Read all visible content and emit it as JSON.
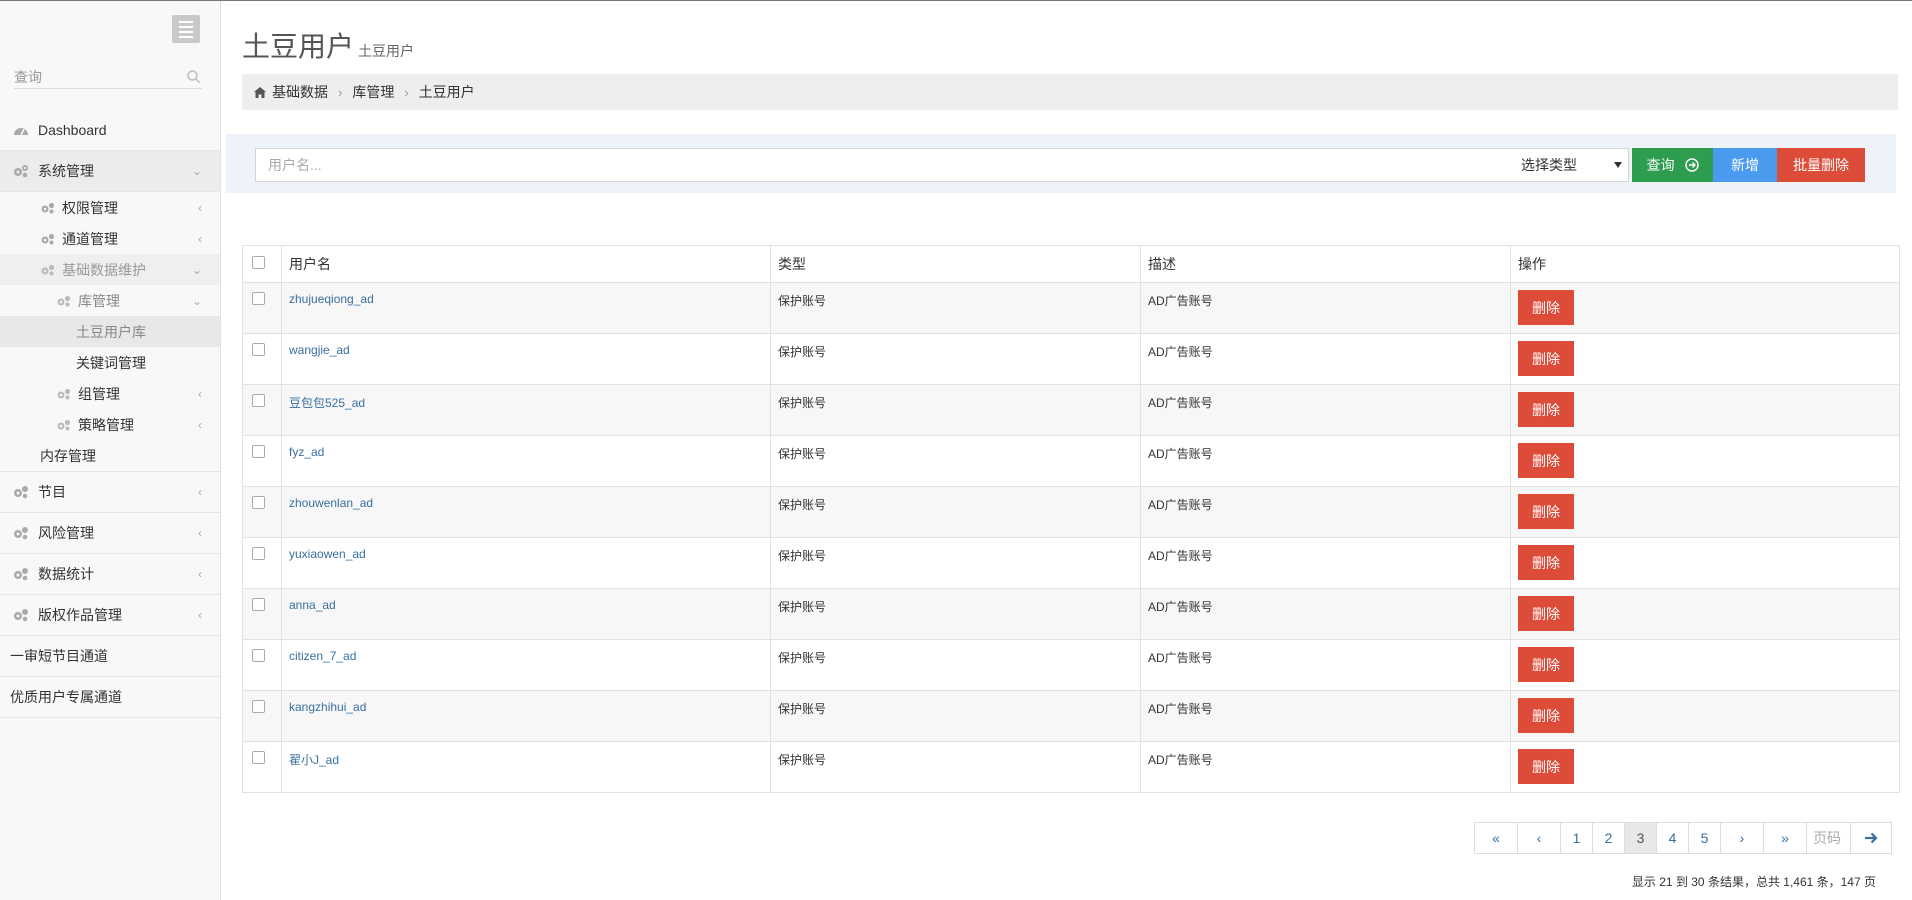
{
  "sidebar": {
    "search_placeholder": "查询",
    "menu": [
      {
        "label": "Dashboard"
      },
      {
        "label": "系统管理"
      },
      {
        "label": "权限管理"
      },
      {
        "label": "通道管理"
      },
      {
        "label": "基础数据维护"
      },
      {
        "label": "库管理"
      },
      {
        "label": "土豆用户库"
      },
      {
        "label": "关键词管理"
      },
      {
        "label": "组管理"
      },
      {
        "label": "策略管理"
      },
      {
        "label": "内存管理"
      },
      {
        "label": "节目"
      },
      {
        "label": "风险管理"
      },
      {
        "label": "数据统计"
      },
      {
        "label": "版权作品管理"
      },
      {
        "label": "一审短节目通道"
      },
      {
        "label": "优质用户专属通道"
      }
    ]
  },
  "header": {
    "title": "土豆用户",
    "subtitle": "土豆用户"
  },
  "breadcrumb": [
    "基础数据",
    "库管理",
    "土豆用户"
  ],
  "filter": {
    "username_placeholder": "用户名...",
    "type_select_value": "选择类型",
    "query_label": "查询",
    "add_label": "新增",
    "batch_delete_label": "批量删除"
  },
  "table": {
    "headers": [
      "用户名",
      "类型",
      "描述",
      "操作"
    ],
    "delete_label": "删除",
    "rows": [
      {
        "username": "zhujueqiong_ad",
        "type": "保护账号",
        "desc": "AD广告账号"
      },
      {
        "username": "wangjie_ad",
        "type": "保护账号",
        "desc": "AD广告账号"
      },
      {
        "username": "豆包包525_ad",
        "type": "保护账号",
        "desc": "AD广告账号"
      },
      {
        "username": "fyz_ad",
        "type": "保护账号",
        "desc": "AD广告账号"
      },
      {
        "username": "zhouwenlan_ad",
        "type": "保护账号",
        "desc": "AD广告账号"
      },
      {
        "username": "yuxiaowen_ad",
        "type": "保护账号",
        "desc": "AD广告账号"
      },
      {
        "username": "anna_ad",
        "type": "保护账号",
        "desc": "AD广告账号"
      },
      {
        "username": "citizen_7_ad",
        "type": "保护账号",
        "desc": "AD广告账号"
      },
      {
        "username": "kangzhihui_ad",
        "type": "保护账号",
        "desc": "AD广告账号"
      },
      {
        "username": "翟小J_ad",
        "type": "保护账号",
        "desc": "AD广告账号"
      }
    ]
  },
  "pagination": {
    "first": "«",
    "prev": "‹",
    "pages": [
      "1",
      "2",
      "3",
      "4",
      "5"
    ],
    "current_page": "3",
    "next": "›",
    "last": "»",
    "page_input_placeholder": "页码",
    "summary": "显示 21 到 30 条结果，总共 1,461 条，147 页"
  },
  "colors": {
    "query_button": "#2e9d4f",
    "add_button": "#4a9bef",
    "delete_button": "#dd4b39",
    "link": "#3a6fa1"
  }
}
